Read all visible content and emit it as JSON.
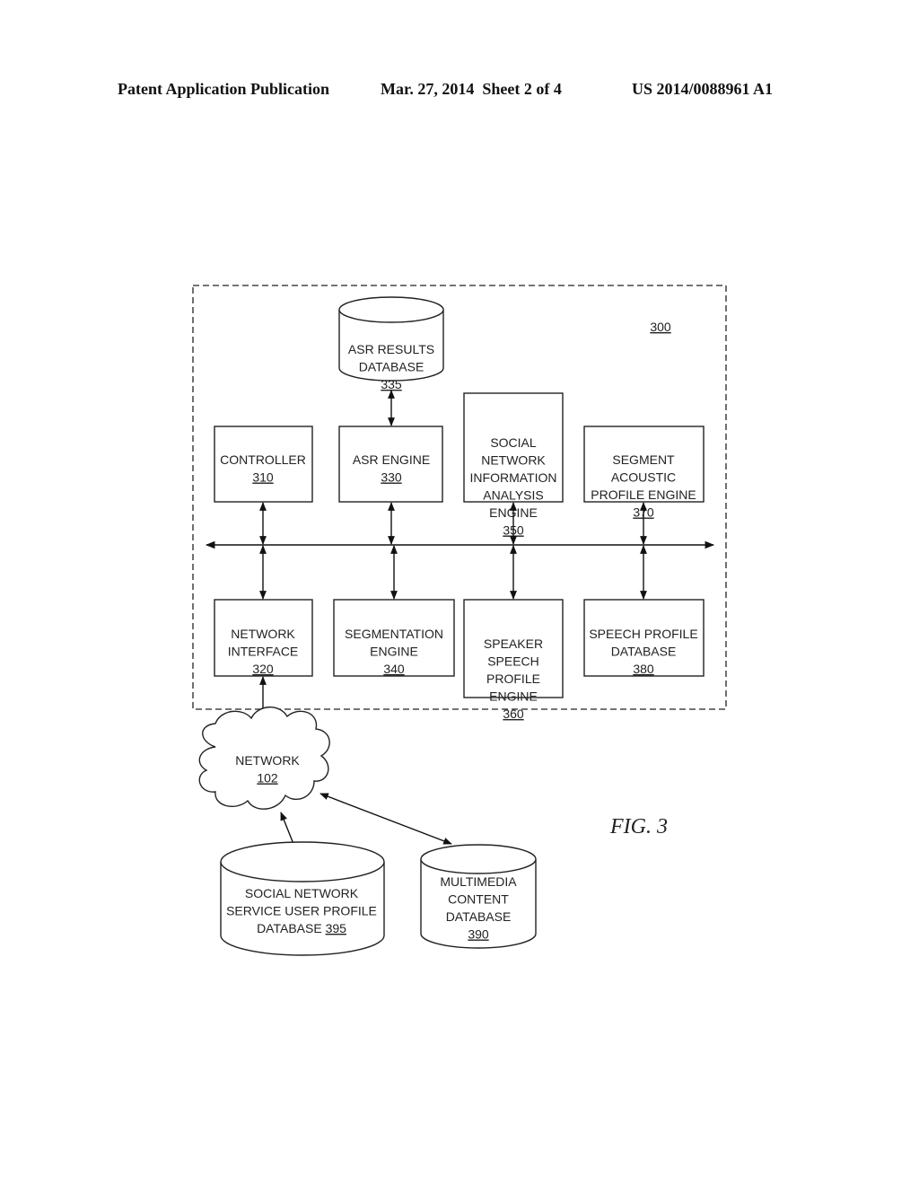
{
  "header": {
    "publication": "Patent Application Publication",
    "date_sheet": "Mar. 27, 2014  Sheet 2 of 4",
    "patent_number": "US 2014/0088961 A1"
  },
  "figure": {
    "label": "FIG. 3",
    "system_ref": "300",
    "nodes": {
      "asr_results_db": {
        "lines": [
          "ASR RESULTS",
          "DATABASE"
        ],
        "ref": "335"
      },
      "controller": {
        "lines": [
          "CONTROLLER"
        ],
        "ref": "310"
      },
      "asr_engine": {
        "lines": [
          "ASR ENGINE"
        ],
        "ref": "330"
      },
      "sn_info_engine": {
        "lines": [
          "SOCIAL",
          "NETWORK",
          "INFORMATION",
          "ANALYSIS",
          "ENGINE"
        ],
        "ref": "350"
      },
      "segment_acoustic": {
        "lines": [
          "SEGMENT",
          "ACOUSTIC",
          "PROFILE ENGINE"
        ],
        "ref": "370"
      },
      "network_interface": {
        "lines": [
          "NETWORK",
          "INTERFACE"
        ],
        "ref": "320"
      },
      "segmentation_engine": {
        "lines": [
          "SEGMENTATION",
          "ENGINE"
        ],
        "ref": "340"
      },
      "speaker_speech": {
        "lines": [
          "SPEAKER",
          "SPEECH",
          "PROFILE",
          "ENGINE"
        ],
        "ref": "360"
      },
      "speech_profile_db": {
        "lines": [
          "SPEECH PROFILE",
          "DATABASE"
        ],
        "ref": "380"
      },
      "network": {
        "lines": [
          "NETWORK"
        ],
        "ref": "102"
      },
      "sn_user_profile_db": {
        "lines": [
          "SOCIAL NETWORK",
          "SERVICE USER PROFILE",
          "DATABASE"
        ],
        "ref": "395"
      },
      "multimedia_db": {
        "lines": [
          "MULTIMEDIA",
          "CONTENT",
          "DATABASE"
        ],
        "ref": "390"
      }
    }
  }
}
